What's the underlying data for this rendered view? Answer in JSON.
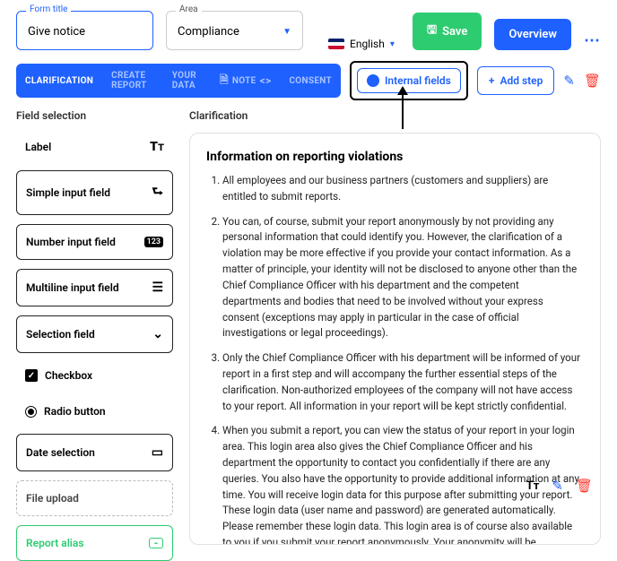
{
  "form": {
    "title_label": "Form title",
    "title_value": "Give notice",
    "area_label": "Area",
    "area_value": "Compliance"
  },
  "lang": {
    "name": "English"
  },
  "buttons": {
    "save": "Save",
    "overview": "Overview",
    "add_step": "Add step",
    "internal": "Internal fields"
  },
  "tabs": [
    "CLARIFICATION",
    "CREATE REPORT",
    "YOUR DATA",
    "NOTE",
    "CONSENT"
  ],
  "sections": {
    "field_selection": "Field selection",
    "clarification": "Clarification"
  },
  "fields": {
    "label": "Label",
    "simple": "Simple input field",
    "number": "Number input field",
    "multiline": "Multiline input field",
    "selection": "Selection field",
    "checkbox": "Checkbox",
    "radio": "Radio button",
    "date": "Date selection",
    "upload": "File upload",
    "alias": "Report alias"
  },
  "info": {
    "title": "Information on reporting violations",
    "items": [
      "All employees and our business partners (customers and suppliers) are entitled to submit reports.",
      "You can, of course, submit your report anonymously by not providing any personal information that could identify you. However, the clarification of a violation may be more effective if you provide your contact information. As a matter of principle, your identity will not be disclosed to anyone other than the Chief Compliance Officer with his department and the competent departments and bodies that need to be involved without your express consent (exceptions may apply in particular in the case of official investigations or legal proceedings).",
      "Only the Chief Compliance Officer with his department will be informed of your report in a first step and will accompany the further essential steps of the clarification. Non-authorized employees of the company will not have access to your report. All information in your report will be kept strictly confidential.",
      "When you submit a report, you can view the status of your report in your login area. This login area also gives the Chief Compliance Officer and his department the opportunity to contact you confidentially if there are any queries. You also have the opportunity to provide additional information at any time. You will receive login data for this purpose after submitting your report. These login data (user name and password) are generated automatically. Please remember these login data. This login area is of course also available to you if you submit your report anonymously. Your anonymity will be preserved."
    ]
  }
}
